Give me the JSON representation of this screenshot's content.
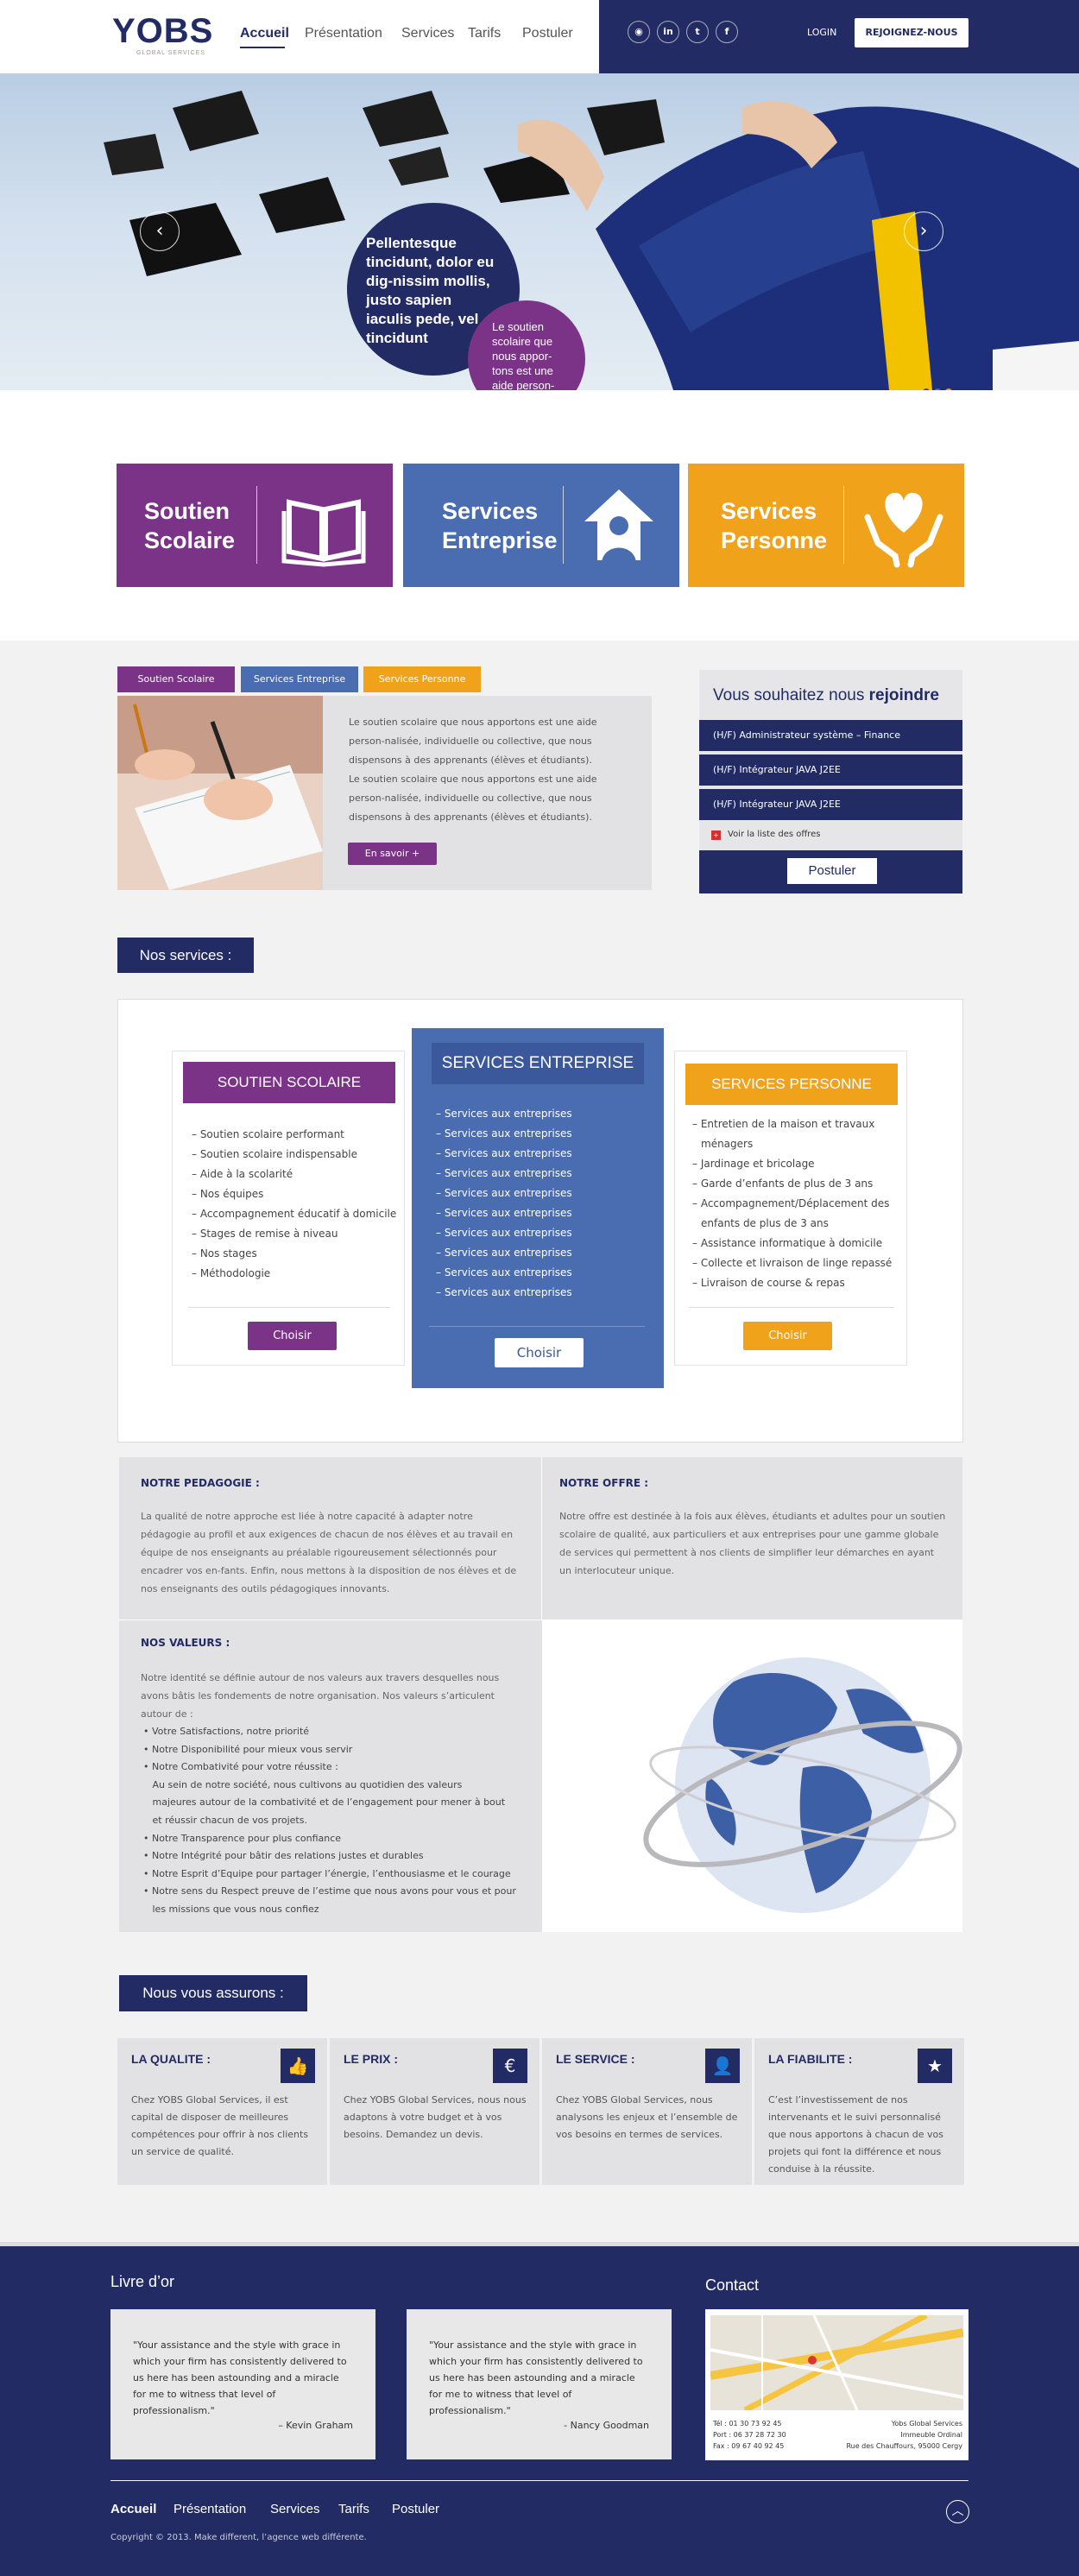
{
  "header": {
    "logo": "YOBS",
    "logo_sub": "GLOBAL SERVICES",
    "nav": [
      "Accueil",
      "Présentation",
      "Services",
      "Tarifs",
      "Postuler"
    ],
    "social": [
      "rss-icon",
      "linkedin-icon",
      "twitter-icon",
      "facebook-icon"
    ],
    "login": "LOGIN",
    "join": "REJOIGNEZ-NOUS"
  },
  "hero": {
    "main_text": "Pellentesque tincidunt, dolor eu dig-nissim mollis, justo sapien iaculis pede, vel tincidunt",
    "sub_text": "Le soutien scolaire que nous appor-tons est une aide person-",
    "dots": [
      "#7b3387",
      "#4a6fb3",
      "#f0a01d"
    ]
  },
  "tiles": [
    {
      "label1": "Soutien",
      "label2": "Scolaire",
      "color": "#7b3387",
      "icon": "book-icon"
    },
    {
      "label1": "Services",
      "label2": "Entreprise",
      "color": "#4a6cb0",
      "icon": "house-person-icon"
    },
    {
      "label1": "Services",
      "label2": "Personne",
      "color": "#f0a21b",
      "icon": "heart-hands-icon"
    }
  ],
  "tabs": {
    "items": [
      "Soutien Scolaire",
      "Services Entreprise",
      "Services Personne"
    ],
    "text": "Le soutien scolaire que nous apportons est une aide person-nalisée, individuelle ou collective, que nous dispensons à des apprenants (élèves et étudiants).",
    "text2": "Le soutien scolaire que nous apportons est une aide person-nalisée, individuelle ou collective, que nous dispensons à des apprenants (élèves et étudiants).",
    "more": "En savoir +"
  },
  "jobs": {
    "title_pre": "Vous souhaitez nous ",
    "title_bold": "rejoindre",
    "items": [
      "(H/F) Administrateur système – Finance",
      "(H/F) Intégrateur JAVA J2EE",
      "(H/F) Intégrateur JAVA J2EE"
    ],
    "all": "Voir la liste des offres",
    "apply": "Postuler"
  },
  "services": {
    "label": "Nos services :",
    "plans": [
      {
        "title": "SOUTIEN SCOLAIRE",
        "color": "#7b3387",
        "items": [
          "– Soutien scolaire performant",
          "– Soutien scolaire indispensable",
          "– Aide à la scolarité",
          "– Nos équipes",
          "– Accompagnement éducatif à domicile",
          "– Stages de remise à niveau",
          "– Nos stages",
          "– Méthodologie"
        ],
        "button": "Choisir"
      },
      {
        "title": "SERVICES ENTREPRISE",
        "color": "#4a6cb0",
        "items": [
          "– Services aux entreprises",
          "– Services aux entreprises",
          "– Services aux entreprises",
          "– Services aux entreprises",
          "– Services aux entreprises",
          "– Services aux entreprises",
          "– Services aux entreprises",
          "– Services aux entreprises",
          "– Services aux entreprises",
          "– Services aux entreprises"
        ],
        "button": "Choisir"
      },
      {
        "title": "SERVICES PERSONNE",
        "color": "#f0a21b",
        "items": [
          "– Entretien de la maison et travaux",
          "ménagers",
          "– Jardinage et bricolage",
          "– Garde d’enfants de plus de 3 ans",
          "– Accompagnement/Déplacement des",
          "enfants de plus de 3 ans",
          "– Assistance informatique à domicile",
          "– Collecte et livraison de linge repassé",
          "– Livraison de course & repas"
        ],
        "button": "Choisir"
      }
    ]
  },
  "info": {
    "ped_title": "NOTRE PEDAGOGIE :",
    "ped_text": "La qualité de notre approche est liée à notre capacité à adapter notre pédagogie au profil et aux exigences de chacun de nos élèves et au travail en équipe de nos enseignants au préalable rigoureusement sélectionnés pour encadrer vos en-fants. Enfin, nous mettons à la disposition de nos élèves et de nos enseignants des outils pédagogiques innovants.",
    "offre_title": "NOTRE OFFRE :",
    "offre_text": "Notre offre est destinée à la fois aux élèves, étudiants et adultes pour un soutien scolaire de qualité, aux particuliers et aux entreprises pour une gamme globale de services qui permettent à nos clients de simplifier leur démarches en ayant un interlocuteur unique.",
    "val_title": "NOS VALEURS :",
    "val_intro": "Notre identité se définie autour de nos valeurs aux travers desquelles nous avons bâtis les fondements de notre organisation. Nos valeurs s’articulent autour de :",
    "val_items": [
      "• Votre Satisfactions, notre priorité",
      "• Notre Disponibilité pour mieux vous servir",
      "• Notre Combativité pour votre réussite :",
      "   Au sein de notre société, nous cultivons au quotidien des valeurs",
      "   majeures autour de la combativité et de l’engagement pour mener à bout",
      "   et réussir chacun de vos projets.",
      "• Notre Transparence pour plus confiance",
      "• Notre Intégrité pour bâtir des relations justes et durables",
      "• Notre Esprit d’Equipe pour partager l’énergie, l’enthousiasme et le courage",
      "• Notre sens du Respect preuve de l’estime que nous avons pour vous et pour",
      "   les missions que vous nous confiez"
    ]
  },
  "assure": {
    "label": "Nous vous assurons :",
    "cards": [
      {
        "title": "LA QUALITE :",
        "icon": "thumbs-up-icon",
        "glyph": "👍",
        "text": "Chez YOBS Global Services, il est capital de disposer de meilleures compétences pour offrir à nos clients un service de qualité."
      },
      {
        "title": "LE PRIX :",
        "icon": "euro-icon",
        "glyph": "€",
        "text": "Chez YOBS Global Services, nous nous adaptons à votre budget et à vos besoins. Demandez un devis."
      },
      {
        "title": "LE SERVICE :",
        "icon": "person-icon",
        "glyph": "👤",
        "text": "Chez YOBS Global Services, nous analysons les enjeux et l’ensemble de vos besoins en termes de services."
      },
      {
        "title": "LA FIABILITE :",
        "icon": "star-icon",
        "glyph": "★",
        "text": "C’est l’investissement de nos intervenants et le suivi personnalisé que nous apportons à chacun de vos projets qui font la différence et nous conduise à la réussite."
      }
    ]
  },
  "footer": {
    "livre": "Livre d’or",
    "contact": "Contact",
    "quotes": [
      {
        "text": "\"Your assistance and the style with grace in which your firm has consistently delivered to us here has been astounding and a miracle for me to witness that level of professionalism.\"",
        "author": "– Kevin Graham"
      },
      {
        "text": "\"Your assistance and the style with grace in which your firm has consistently delivered to us here has been astounding and a miracle for me to witness that level of professionalism.\"",
        "author": "- Nancy Goodman"
      }
    ],
    "tel": "Tél : 01 30 73 92 45",
    "port": "Port : 06 37 28 72 30",
    "fax": "Fax : 09 67 40 92 45",
    "company": "Yobs Global Services",
    "bldg": "Immeuble Ordinal",
    "addr": "Rue des Chauffours, 95000 Cergy",
    "nav": [
      "Accueil",
      "Présentation",
      "Services",
      "Tarifs",
      "Postuler"
    ],
    "copyright": "Copyright © 2013. Make different, l’agence web différente."
  }
}
